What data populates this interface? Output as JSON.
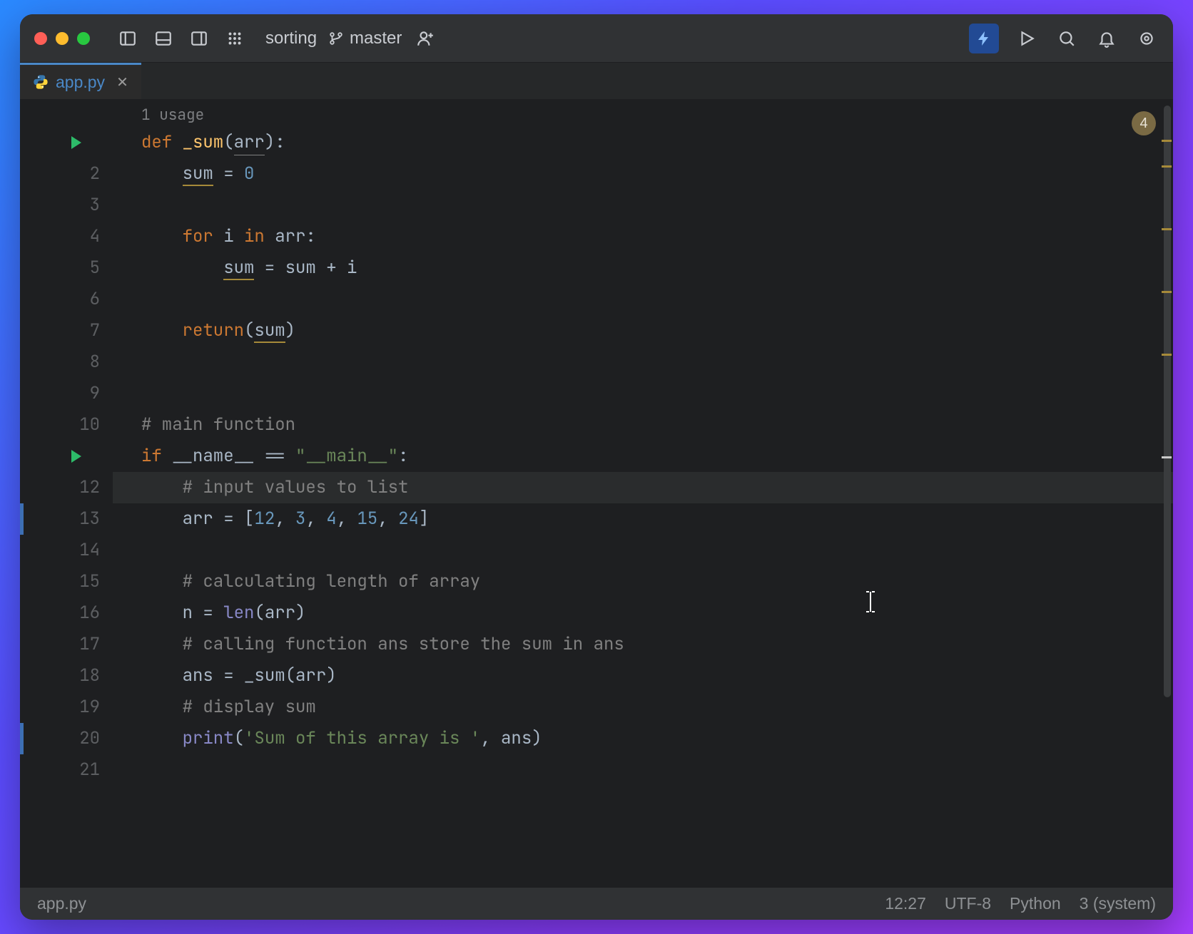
{
  "titlebar": {
    "project": "sorting",
    "branch": "master"
  },
  "tab": {
    "filename": "app.py"
  },
  "inspection_badge": "4",
  "usage_hint": "1 usage",
  "gutter": {
    "lines": [
      "",
      "2",
      "3",
      "4",
      "5",
      "6",
      "7",
      "8",
      "9",
      "10",
      "",
      "12",
      "13",
      "14",
      "15",
      "16",
      "17",
      "18",
      "19",
      "20",
      "21"
    ],
    "run_markers": [
      0,
      10
    ]
  },
  "code": {
    "l1": {
      "kw": "def ",
      "fn": "_sum",
      "p1": "(",
      "arg": "arr",
      "p2": "):"
    },
    "l2": {
      "a": "sum",
      "b": " = ",
      "c": "0"
    },
    "l4": {
      "a": "for ",
      "b": "i ",
      "c": "in ",
      "d": "arr:"
    },
    "l5": {
      "a": "sum",
      "b": " = ",
      "c": "sum",
      "d": " + i"
    },
    "l7": {
      "a": "return",
      "b": "(",
      "c": "sum",
      "d": ")"
    },
    "l10": "# main function",
    "l11": {
      "a": "if ",
      "b": "__name__ ",
      "c": "== ",
      "d": "\"__main__\"",
      "e": ":"
    },
    "l12": "# input values to list",
    "l13": {
      "a": "arr = [",
      "n1": "12",
      "c1": ", ",
      "n2": "3",
      "c2": ", ",
      "n3": "4",
      "c3": ", ",
      "n4": "15",
      "c4": ", ",
      "n5": "24",
      "b": "]"
    },
    "l15": "# calculating length of array",
    "l16": {
      "a": "n = ",
      "b": "len",
      "c": "(arr)"
    },
    "l17": "# calling function ans store the sum in ans",
    "l18": {
      "a": "ans = ",
      "b": "_sum",
      "c": "(arr)"
    },
    "l19": "# display sum",
    "l20": {
      "a": "print",
      "b": "(",
      "c": "'Sum of this array is '",
      "d": ", ans)"
    }
  },
  "statusbar": {
    "file": "app.py",
    "pos": "12:27",
    "encoding": "UTF-8",
    "lang": "Python",
    "interp": "3 (system)"
  }
}
